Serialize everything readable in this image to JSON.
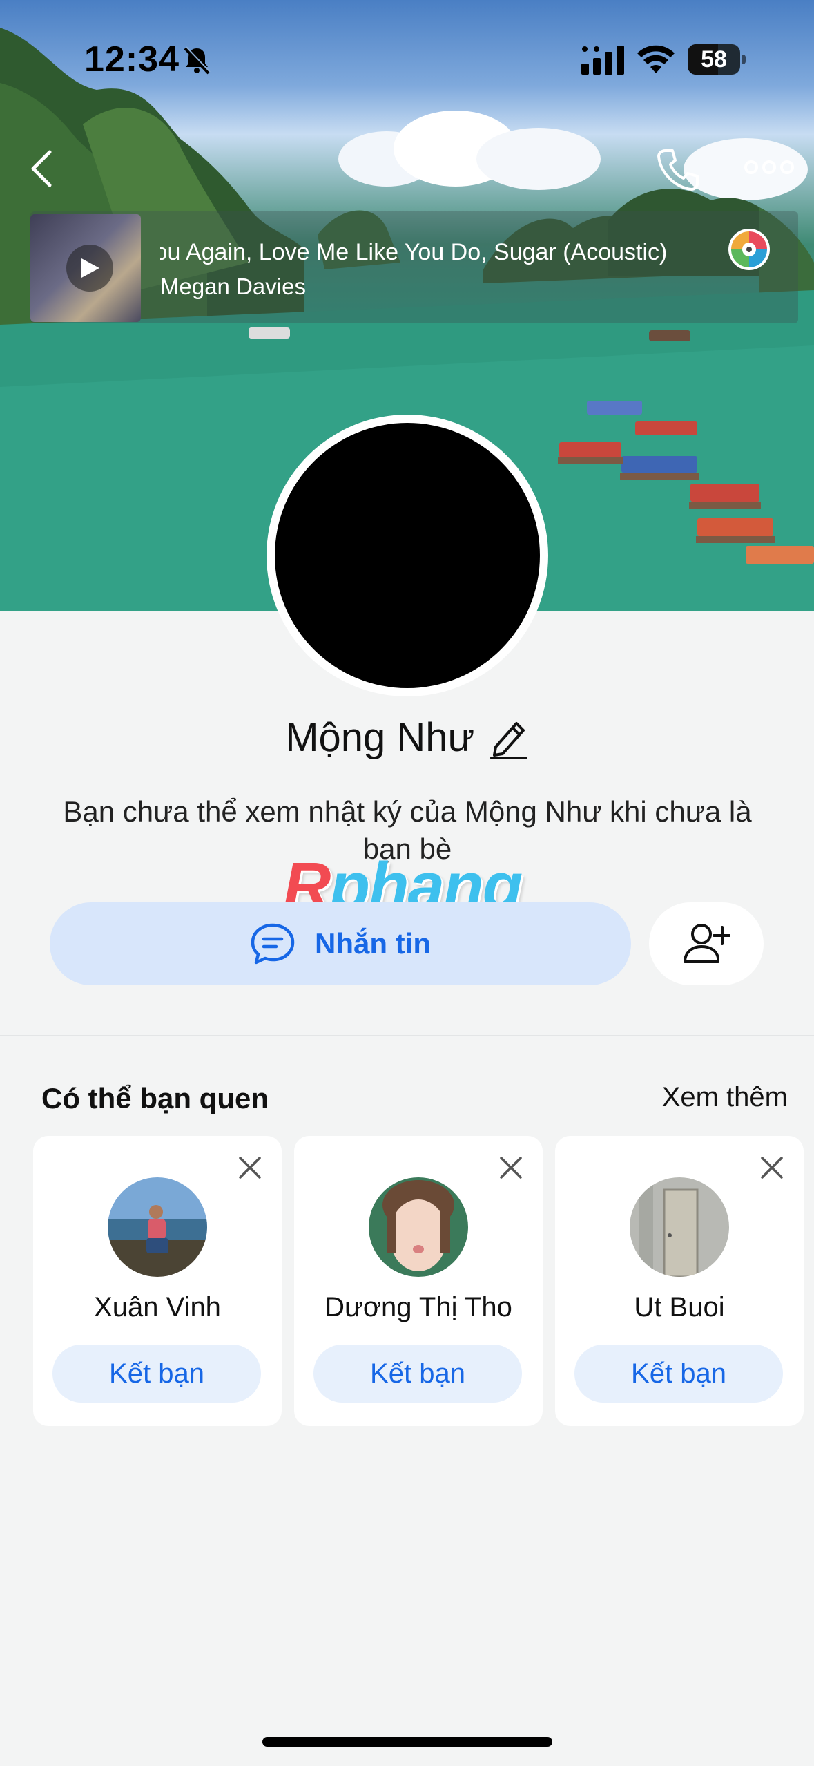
{
  "status_bar": {
    "time": "12:34",
    "battery_level": "58",
    "battery_fraction": 0.58
  },
  "music": {
    "song": "You Again, Love Me Like You Do, Sugar (Acoustic)",
    "artist": "Megan Davies"
  },
  "profile": {
    "name": "Mộng Như",
    "description": "Bạn chưa thể xem nhật ký của Mộng Như khi chưa là bạn bè"
  },
  "watermark": {
    "part1": "R",
    "part2": "phang"
  },
  "actions": {
    "message_label": "Nhắn tin"
  },
  "suggestions": {
    "title": "Có thể bạn quen",
    "see_more": "Xem thêm",
    "items": [
      {
        "name": "Xuân Vinh",
        "button": "Kết bạn"
      },
      {
        "name": "Dương Thị Tho",
        "button": "Kết bạn"
      },
      {
        "name": "Ut Buoi",
        "button": "Kết bạn"
      }
    ]
  },
  "colors": {
    "accent": "#1767e6",
    "message_bg": "#d8e6fb",
    "friend_bg": "#e7f0fc",
    "page_bg": "#f3f4f4"
  }
}
